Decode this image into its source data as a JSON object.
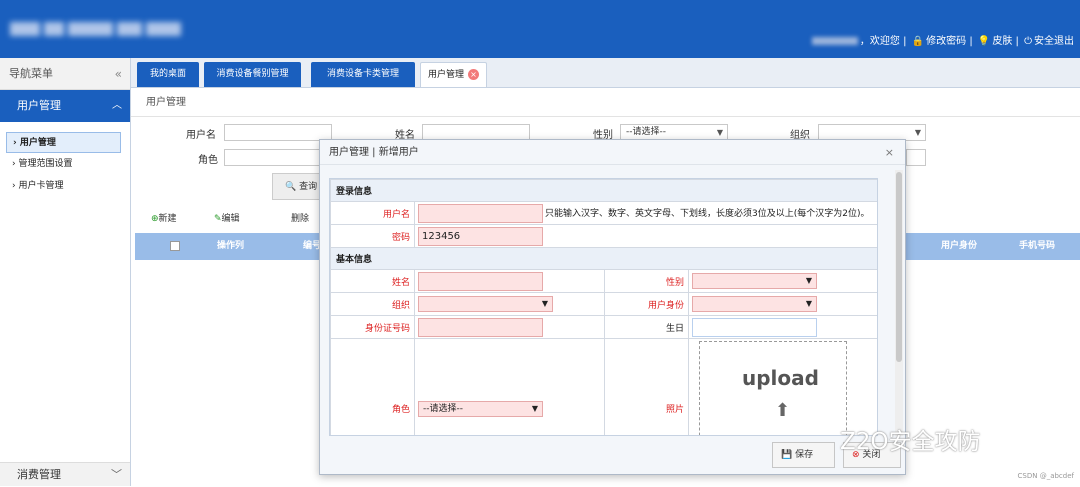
{
  "header": {
    "logo_text": "",
    "welcome": "，欢迎您",
    "change_password": "修改密码",
    "skin": "皮肤",
    "logout": "安全退出",
    "separator": "|"
  },
  "sidebar": {
    "title": "导航菜单",
    "collapse_glyph": "«",
    "group": "用户管理",
    "items": [
      {
        "label": "用户管理",
        "active": true
      },
      {
        "label": "管理范围设置",
        "active": false
      },
      {
        "label": "用户卡管理",
        "active": false
      }
    ],
    "bottom_group": "消费管理"
  },
  "tabs": [
    {
      "label": "我的桌面",
      "active": false
    },
    {
      "label": "消费设备餐别管理",
      "active": false
    },
    {
      "label": "消费设备卡类管理",
      "active": false
    },
    {
      "label": "用户管理",
      "active": true
    }
  ],
  "breadcrumb": "用户管理",
  "search": {
    "username_label": "用户名",
    "name_label": "姓名",
    "gender_label": "性别",
    "gender_value": "--请选择--",
    "org_label": "组织",
    "role_label": "角色",
    "query_button": "查询"
  },
  "toolbar": {
    "new": "新建",
    "edit": "编辑",
    "delete": "删除"
  },
  "table": {
    "columns": [
      "操作列",
      "编号",
      "用户身份",
      "手机号码"
    ]
  },
  "dialog": {
    "title": "用户管理 | 新增用户",
    "close": "×",
    "login_section": "登录信息",
    "username_label": "用户名",
    "username_hint": "只能输入汉字、数字、英文字母、下划线，长度必须3位及以上(每个汉字为2位)。",
    "password_label": "密码",
    "password_value": "123456",
    "basic_section": "基本信息",
    "name_label": "姓名",
    "gender_label": "性别",
    "org_label": "组织",
    "identity_label": "用户身份",
    "idcard_label": "身份证号码",
    "birthday_label": "生日",
    "role_label": "角色",
    "role_value": "--请选择--",
    "photo_label": "照片",
    "upload_text": "upload",
    "save_button": "保存",
    "close_button": "关闭"
  },
  "watermark": "Z2O安全攻防",
  "credit": "CSDN @_abcdef",
  "colors": {
    "primary": "#1a5fbe",
    "header_row": "#99bce8",
    "required_red": "#dd2222",
    "required_fill": "#fde3e3"
  }
}
